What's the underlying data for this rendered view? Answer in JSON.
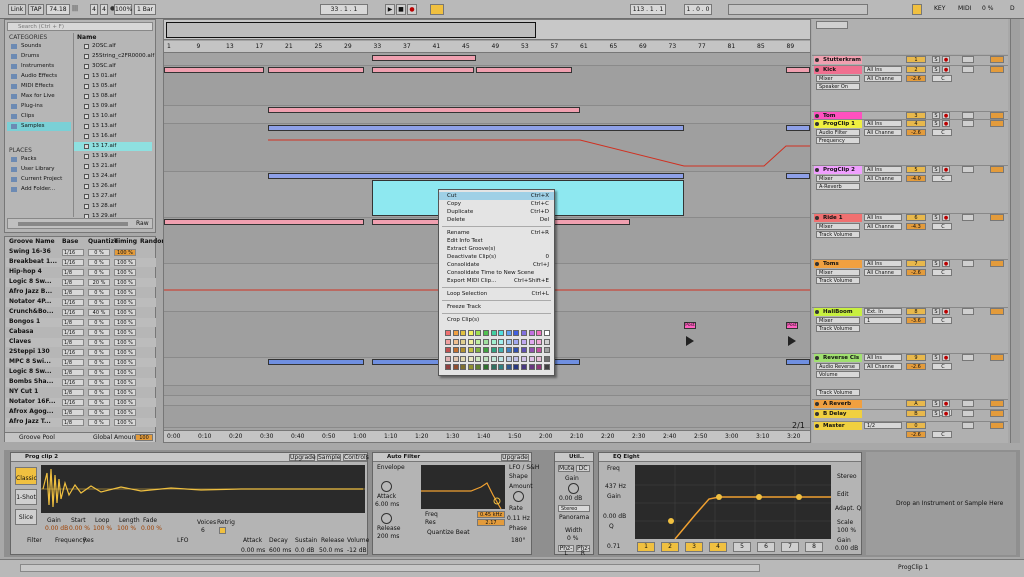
{
  "topbar": {
    "link": "Link",
    "tap": "TAP",
    "tempo": "74.18",
    "nudge": "|||",
    "sig_num": "4",
    "sig_den": "4",
    "metro": "●",
    "zoom": "100%",
    "loop_mode": "1 Bar",
    "position": "33 . 1 . 1",
    "play": "▶",
    "stop": "■",
    "record": "●",
    "loop_start": "113 . 1 . 1",
    "loop_len": "1 . 0 . 0",
    "key": "KEY",
    "midi": "MIDI",
    "cpu": "0 %",
    "d_label": "D"
  },
  "browser": {
    "search_placeholder": "Search (Ctrl + F)",
    "categories_header": "CATEGORIES",
    "categories": [
      "Sounds",
      "Drums",
      "Instruments",
      "Audio Effects",
      "MIDI Effects",
      "Max for Live",
      "Plug-ins",
      "Clips",
      "Samples"
    ],
    "places_header": "PLACES",
    "places": [
      "Packs",
      "User Library",
      "Current Project",
      "Add Folder..."
    ],
    "name_header": "Name",
    "files": [
      "2OSC.alf",
      "25String_c2FR0000.alf",
      "3OSC.alf",
      "13 01.aif",
      "13 05.aif",
      "13 08.aif",
      "13 09.aif",
      "13 10.aif",
      "13 13.aif",
      "13 16.aif",
      "13 17.aif",
      "13 19.aif",
      "13 21.aif",
      "13 24.aif",
      "13 26.aif",
      "13 27.aif",
      "13 28.aif",
      "13 29.aif",
      "13 33.aif"
    ],
    "preview_label": "Raw"
  },
  "groove": {
    "headers": [
      "Groove Name",
      "Base",
      "Quantize",
      "Timing",
      "Random"
    ],
    "rows": [
      {
        "name": "Swing 16-36",
        "base": "1/16",
        "q": "0 %",
        "t": "100 %"
      },
      {
        "name": "Breakbeat 1...",
        "base": "1/16",
        "q": "0 %",
        "t": "100 %"
      },
      {
        "name": "Hip-hop 4",
        "base": "1/8",
        "q": "0 %",
        "t": "100 %"
      },
      {
        "name": "Logic 8 Sw...",
        "base": "1/8",
        "q": "20 %",
        "t": "100 %"
      },
      {
        "name": "Afro Jazz B...",
        "base": "1/8",
        "q": "0 %",
        "t": "100 %"
      },
      {
        "name": "Notator 4P...",
        "base": "1/16",
        "q": "0 %",
        "t": "100 %"
      },
      {
        "name": "Crunch&Bo...",
        "base": "1/16",
        "q": "40 %",
        "t": "100 %"
      },
      {
        "name": "Bongos 1",
        "base": "1/8",
        "q": "0 %",
        "t": "100 %"
      },
      {
        "name": "Cabasa",
        "base": "1/16",
        "q": "0 %",
        "t": "100 %"
      },
      {
        "name": "Claves",
        "base": "1/8",
        "q": "0 %",
        "t": "100 %"
      },
      {
        "name": "2Steppi 130",
        "base": "1/16",
        "q": "0 %",
        "t": "100 %"
      },
      {
        "name": "MPC 8 Swi...",
        "base": "1/8",
        "q": "0 %",
        "t": "100 %"
      },
      {
        "name": "Logic 8 Sw...",
        "base": "1/8",
        "q": "0 %",
        "t": "100 %"
      },
      {
        "name": "Bombs Sha...",
        "base": "1/16",
        "q": "0 %",
        "t": "100 %"
      },
      {
        "name": "NY Cut 1",
        "base": "1/8",
        "q": "0 %",
        "t": "100 %"
      },
      {
        "name": "Notator 16F...",
        "base": "1/16",
        "q": "0 %",
        "t": "100 %"
      },
      {
        "name": "Afrox Agog...",
        "base": "1/8",
        "q": "0 %",
        "t": "100 %"
      },
      {
        "name": "Afro Jazz T...",
        "base": "1/8",
        "q": "0 %",
        "t": "100 %"
      }
    ],
    "footer_left": "Groove Pool",
    "footer_right": "Global Amount",
    "global_amount": "100"
  },
  "ruler": [
    "1",
    "9",
    "13",
    "17",
    "21",
    "25",
    "29",
    "33",
    "37",
    "41",
    "45",
    "49",
    "53",
    "57",
    "61",
    "65",
    "69",
    "73",
    "77",
    "81",
    "85",
    "89"
  ],
  "time_ruler": [
    "0:00",
    "0:10",
    "0:20",
    "0:30",
    "0:40",
    "0:50",
    "1:00",
    "1:10",
    "1:20",
    "1:30",
    "1:40",
    "1:50",
    "2:00",
    "2:10",
    "2:20",
    "2:30",
    "2:40",
    "2:50",
    "3:00",
    "3:10",
    "3:20"
  ],
  "page_indicator": "2/1",
  "tracks": [
    {
      "name": "Stutterkram",
      "color": "#f0a0b0",
      "input": "",
      "mode": "",
      "vol": "",
      "num": "1",
      "pan": "",
      "a": "S",
      "b": "●"
    },
    {
      "name": "Kick",
      "color": "#f07090",
      "input": "All Ins",
      "mode": "All Channe",
      "vol": "-2.6",
      "num": "2",
      "pan": "C",
      "a": "S",
      "b": "●"
    },
    {
      "name": "Tom",
      "color": "#ff50c0",
      "input": "",
      "mode": "",
      "vol": "",
      "num": "3",
      "pan": "",
      "a": "S",
      "b": "●"
    },
    {
      "name": "ProgClip 1",
      "color": "#f0f040",
      "input": "All Ins",
      "mode": "All Channe",
      "vol": "-2.6",
      "num": "4",
      "pan": "C",
      "a": "S",
      "b": "●"
    },
    {
      "name": "ProgClip 2",
      "color": "#f0a0ff",
      "input": "All Ins",
      "mode": "All Channe",
      "vol": "-4.0",
      "num": "5",
      "pan": "C",
      "a": "S",
      "b": "●"
    },
    {
      "name": "Ride 1",
      "color": "#f07070",
      "input": "All Ins",
      "mode": "All Channe",
      "vol": "-4.3",
      "num": "6",
      "pan": "C",
      "a": "S",
      "b": "●"
    },
    {
      "name": "Toms",
      "color": "#f0a040",
      "input": "All Ins",
      "mode": "All Channe",
      "vol": "-2.6",
      "num": "7",
      "pan": "C",
      "a": "S",
      "b": "●"
    },
    {
      "name": "HaliBoom",
      "color": "#c8f040",
      "input": "Ext. In",
      "mode": "1",
      "vol": "-3.6",
      "num": "8",
      "pan": "C",
      "a": "S",
      "b": "●"
    },
    {
      "name": "Reverse Cls",
      "color": "#a0e070",
      "input": "All Ins",
      "mode": "All Channe",
      "vol": "-2.6",
      "num": "9",
      "pan": "C",
      "a": "S",
      "b": "●"
    },
    {
      "name": "A Reverb",
      "color": "#f0a040",
      "input": "",
      "mode": "",
      "vol": "-2.6",
      "num": "A",
      "pan": "C",
      "a": "S",
      "b": "●"
    },
    {
      "name": "B Delay",
      "color": "#f0d040",
      "input": "",
      "mode": "",
      "vol": "",
      "num": "B",
      "pan": "",
      "a": "S",
      "b": "●"
    },
    {
      "name": "Master",
      "color": "#f0d040",
      "input": "1/2",
      "mode": "",
      "vol": "-2.6",
      "num": "0",
      "pan": "C",
      "a": "",
      "b": ""
    }
  ],
  "track_subs": [
    "Mixer",
    "Speaker On",
    "Audio Filter",
    "Frequency",
    "Mixer",
    "A-Reverb",
    "Mixer",
    "Track Volume",
    "Mixer",
    "Track Volume",
    "Mixer",
    "Track Volume",
    "Audio Reverse",
    "Volume",
    "Track Volume"
  ],
  "lane_markers": [
    "Post",
    "Post"
  ],
  "context_menu": {
    "items": [
      {
        "label": "Cut",
        "shortcut": "Ctrl+X",
        "hl": true
      },
      {
        "label": "Copy",
        "shortcut": "Ctrl+C"
      },
      {
        "label": "Duplicate",
        "shortcut": "Ctrl+D"
      },
      {
        "label": "Delete",
        "shortcut": "Del"
      },
      {
        "sep": true
      },
      {
        "label": "Rename",
        "shortcut": "Ctrl+R"
      },
      {
        "label": "Edit Info Text",
        "shortcut": ""
      },
      {
        "label": "Extract Groove(s)",
        "shortcut": ""
      },
      {
        "label": "Deactivate Clip(s)",
        "shortcut": "0"
      },
      {
        "label": "Consolidate",
        "shortcut": "Ctrl+J"
      },
      {
        "label": "Consolidate Time to New Scene",
        "shortcut": ""
      },
      {
        "label": "Export MIDI Clip...",
        "shortcut": "Ctrl+Shift+E"
      },
      {
        "sep": true
      },
      {
        "label": "Loop Selection",
        "shortcut": "Ctrl+L"
      },
      {
        "sep": true
      },
      {
        "label": "Freeze Track",
        "shortcut": ""
      },
      {
        "sep": true
      },
      {
        "label": "Crop Clip(s)",
        "shortcut": ""
      }
    ],
    "colors": [
      "#f07070",
      "#f0a040",
      "#e0c040",
      "#f0f060",
      "#a0e050",
      "#50c050",
      "#40d0a0",
      "#50e0e0",
      "#60a0f0",
      "#4060e0",
      "#8070e0",
      "#c070e0",
      "#f070c0",
      "#ffffff",
      "#f0a0a0",
      "#f0c090",
      "#e0d090",
      "#f0f0a0",
      "#c0f0a0",
      "#a0e0a0",
      "#a0f0d0",
      "#a0f0f0",
      "#a0c8f0",
      "#a0a8f0",
      "#c0a8f0",
      "#e0a8f0",
      "#f0a8d8",
      "#d0d0d0",
      "#c05050",
      "#c07030",
      "#b09030",
      "#c0c040",
      "#80b040",
      "#40a040",
      "#30a080",
      "#40b0b0",
      "#4080c0",
      "#3050b0",
      "#6050b0",
      "#9050b0",
      "#c050a0",
      "#a0a0a0",
      "#e0b0b0",
      "#e0c8b0",
      "#e0d8b0",
      "#e8e8c0",
      "#d0e8c0",
      "#c0e0c0",
      "#c0e8d8",
      "#c0e8e8",
      "#c0d0e8",
      "#c0c0e8",
      "#d0c0e8",
      "#e0c0e8",
      "#e8c0d8",
      "#707070",
      "#904040",
      "#905030",
      "#807030",
      "#909030",
      "#608030",
      "#307030",
      "#307060",
      "#308080",
      "#305890",
      "#283880",
      "#483880",
      "#683880",
      "#903878",
      "#404040"
    ]
  },
  "devices": {
    "sampler": {
      "title": "Prog clip 2",
      "btn_upgrade": "Upgrade",
      "btn_sample": "Sample",
      "btn_controls": "Controls",
      "mode": "Classic",
      "one_shot": "1-Shot",
      "slice": "Slice",
      "labels": [
        "Gain",
        "Start",
        "Loop",
        "Length",
        "Fade"
      ],
      "values": [
        "0.00 dB",
        "0.00 %",
        "100 %",
        "100 %",
        "0.00 %"
      ],
      "voices_label": "Voices",
      "voices": "6",
      "retrig_label": "Retrig",
      "filter_label": "Filter",
      "frequency_label": "Frequency",
      "res_label": "Res",
      "lfo_label": "LFO",
      "attack_label": "Attack",
      "attack": "0.00 ms",
      "decay_label": "Decay",
      "decay": "600 ms",
      "sustain_label": "Sustain",
      "sustain": "0.0 dB",
      "release_label": "Release",
      "release": "50.0 ms",
      "volume_label": "Volume",
      "volume": "-12 dB"
    },
    "autofilter": {
      "title": "Auto Filter",
      "upgrade": "Upgrade",
      "envelope": "Envelope",
      "lfo": "LFO / S&H",
      "shape": "Shape",
      "amount": "Amount",
      "rate": "Rate",
      "phase": "Phase",
      "freq": "Freq",
      "res": "Res",
      "freq_val": "0.45 kHz",
      "q_val": "2.17",
      "attack": "Attack",
      "release": "Release",
      "attack_val": "6.00 ms",
      "release_val": "200 ms",
      "rate_val": "0.11 Hz",
      "phase_val": "180°",
      "quant": "Quantize Beat"
    },
    "utility": {
      "title": "Util..",
      "mute": "Mute",
      "dc": "DC",
      "gain": "Gain",
      "gain_val": "0.00 dB",
      "panorama": "Panorama",
      "width": "Width",
      "width_val": "0 %",
      "mono": "Phz-L",
      "phz_r": "Phz-R",
      "stereo": "Stereo"
    },
    "eq": {
      "title": "EQ Eight",
      "freq_label": "Freq",
      "freq_val": "437 Hz",
      "gain_label": "Gain",
      "gain_val": "0.00 dB",
      "q_label": "Q",
      "q_val": "0.71",
      "edit": "Edit",
      "adapt": "Adapt. Q",
      "scale": "Scale",
      "scale_val": "100 %",
      "gain2": "Gain",
      "gain2_val": "0.00 dB",
      "stereo": "Stereo",
      "bands": [
        "1",
        "2",
        "3",
        "4",
        "5",
        "6",
        "7",
        "8"
      ]
    },
    "drop_hint": "Drop an Instrument or Sample Here"
  },
  "status": {
    "right": "ProgClip 1"
  }
}
